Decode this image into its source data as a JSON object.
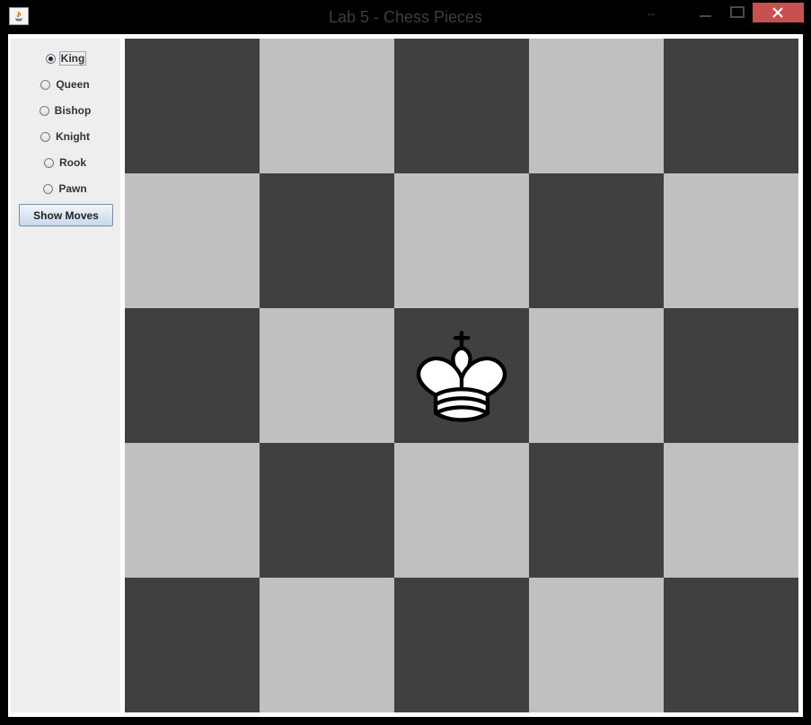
{
  "window": {
    "title": "Lab 5 - Chess Pieces"
  },
  "colors": {
    "dark_square": "#404040",
    "light_square": "#c0c0c0",
    "close_button": "#c75050",
    "panel": "#eeeeee"
  },
  "controls": {
    "pieces": [
      {
        "label": "King",
        "selected": true
      },
      {
        "label": "Queen",
        "selected": false
      },
      {
        "label": "Bishop",
        "selected": false
      },
      {
        "label": "Knight",
        "selected": false
      },
      {
        "label": "Rook",
        "selected": false
      },
      {
        "label": "Pawn",
        "selected": false
      }
    ],
    "show_moves_label": "Show Moves"
  },
  "board": {
    "rows": 5,
    "cols": 5,
    "piece": {
      "name": "king",
      "color": "white",
      "row": 2,
      "col": 2,
      "icon": "white-king-icon"
    }
  }
}
